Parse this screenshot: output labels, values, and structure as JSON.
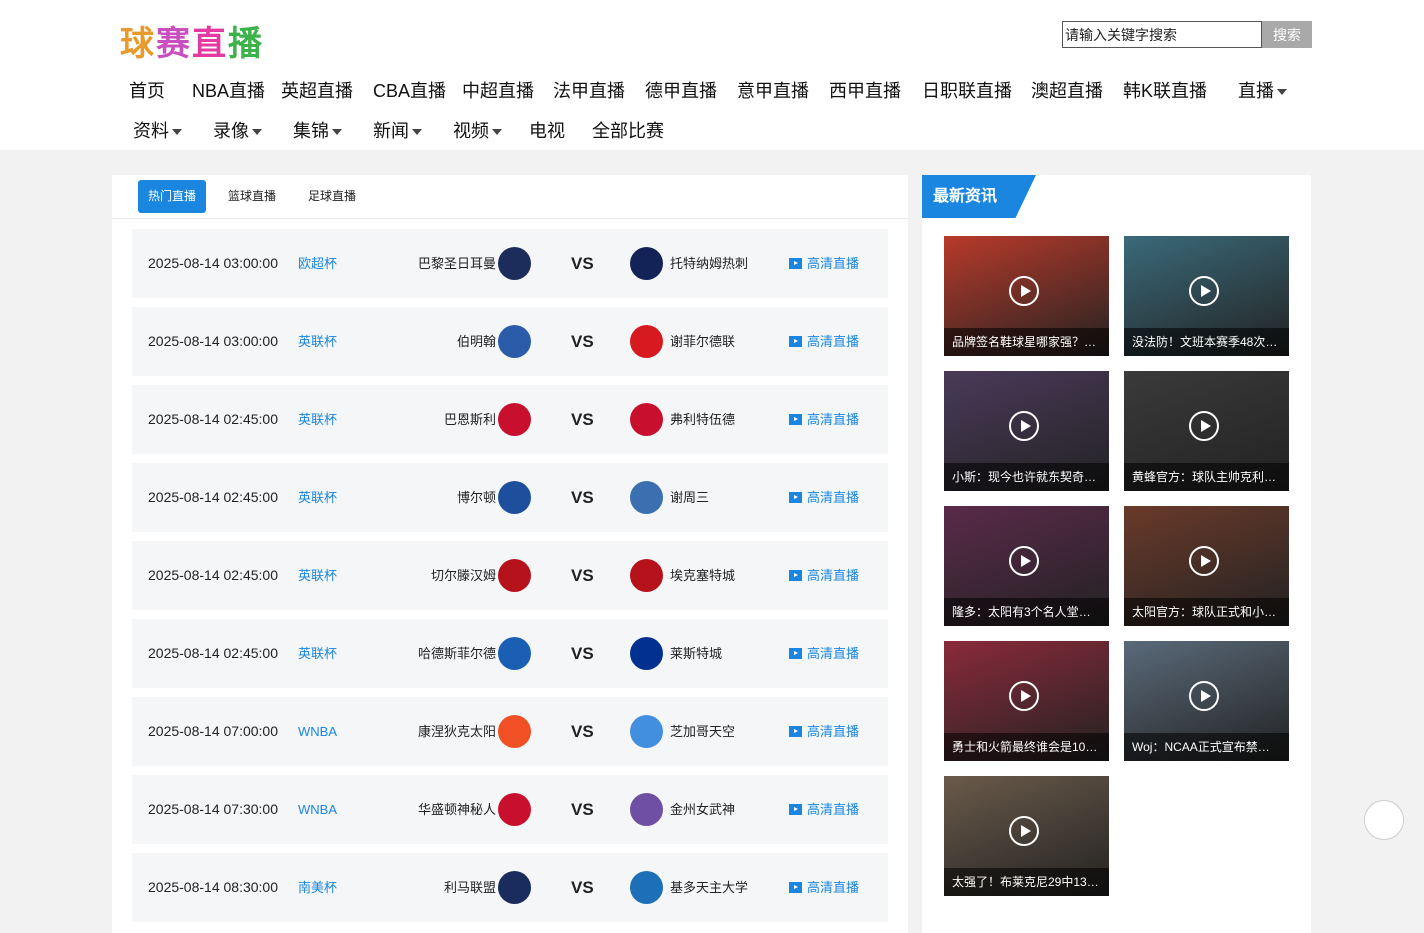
{
  "site": {
    "logo_chars": [
      {
        "char": "球",
        "color": "#e89a2a"
      },
      {
        "char": "赛",
        "color": "#c94fbf"
      },
      {
        "char": "直",
        "color": "#e23aa0"
      },
      {
        "char": "播",
        "color": "#3bb24a"
      }
    ]
  },
  "search": {
    "value": "请输入关键字搜索",
    "button_label": "搜索"
  },
  "nav": {
    "row1": [
      "首页",
      "NBA直播",
      "英超直播",
      "CBA直播",
      "中超直播",
      "法甲直播",
      "德甲直播",
      "意甲直播",
      "西甲直播",
      "日职联直播",
      "澳超直播",
      "韩K联直播",
      "直播"
    ],
    "row2": [
      "资料",
      "录像",
      "集锦",
      "新闻",
      "视频",
      "电视",
      "全部比赛"
    ]
  },
  "tabs": [
    "热门直播",
    "篮球直播",
    "足球直播"
  ],
  "live_label": "高清直播",
  "vs_label": "VS",
  "matches": [
    {
      "time": "2025-08-14 03:00:00",
      "league": "欧超杯",
      "home": "巴黎圣日耳曼",
      "away": "托特纳姆热刺",
      "home_color": "#1c2c5b",
      "away_color": "#132257"
    },
    {
      "time": "2025-08-14 03:00:00",
      "league": "英联杯",
      "home": "伯明翰",
      "away": "谢菲尔德联",
      "home_color": "#2a5caa",
      "away_color": "#d71920"
    },
    {
      "time": "2025-08-14 02:45:00",
      "league": "英联杯",
      "home": "巴恩斯利",
      "away": "弗利特伍德",
      "home_color": "#c8102e",
      "away_color": "#c8102e"
    },
    {
      "time": "2025-08-14 02:45:00",
      "league": "英联杯",
      "home": "博尔顿",
      "away": "谢周三",
      "home_color": "#1d4f9c",
      "away_color": "#3a6fb0"
    },
    {
      "time": "2025-08-14 02:45:00",
      "league": "英联杯",
      "home": "切尔滕汉姆",
      "away": "埃克塞特城",
      "home_color": "#b5121b",
      "away_color": "#b5121b"
    },
    {
      "time": "2025-08-14 02:45:00",
      "league": "英联杯",
      "home": "哈德斯菲尔德",
      "away": "莱斯特城",
      "home_color": "#1a5fb4",
      "away_color": "#003090"
    },
    {
      "time": "2025-08-14 07:00:00",
      "league": "WNBA",
      "home": "康涅狄克太阳",
      "away": "芝加哥天空",
      "home_color": "#f05023",
      "away_color": "#418fde"
    },
    {
      "time": "2025-08-14 07:30:00",
      "league": "WNBA",
      "home": "华盛顿神秘人",
      "away": "金州女武神",
      "home_color": "#c8102e",
      "away_color": "#6f4fa3"
    },
    {
      "time": "2025-08-14 08:30:00",
      "league": "南美杯",
      "home": "利马联盟",
      "away": "基多天主大学",
      "home_color": "#1a2b5e",
      "away_color": "#1d70b8"
    }
  ],
  "news": {
    "title": "最新资讯",
    "items": [
      {
        "caption": "品牌签名鞋球星哪家强？…",
        "color": "#b83a2a"
      },
      {
        "caption": "没法防！文班本赛季48次…",
        "color": "#3a6a7a"
      },
      {
        "caption": "小斯：现今也许就东契奇…",
        "color": "#4a3a5a"
      },
      {
        "caption": "黄蜂官方：球队主帅克利…",
        "color": "#3a3a3a"
      },
      {
        "caption": "隆多：太阳有3个名人堂成…",
        "color": "#5a2a4a"
      },
      {
        "caption": "太阳官方：球队正式和小…",
        "color": "#6a3a2a"
      },
      {
        "caption": "勇士和火箭最终谁会是10…",
        "color": "#8a2a3a"
      },
      {
        "caption": "Woj：NCAA正式宣布禁止博…",
        "color": "#5a6a7a"
      },
      {
        "caption": "太强了！布莱克尼29中13…",
        "color": "#6a5a4a"
      }
    ]
  }
}
